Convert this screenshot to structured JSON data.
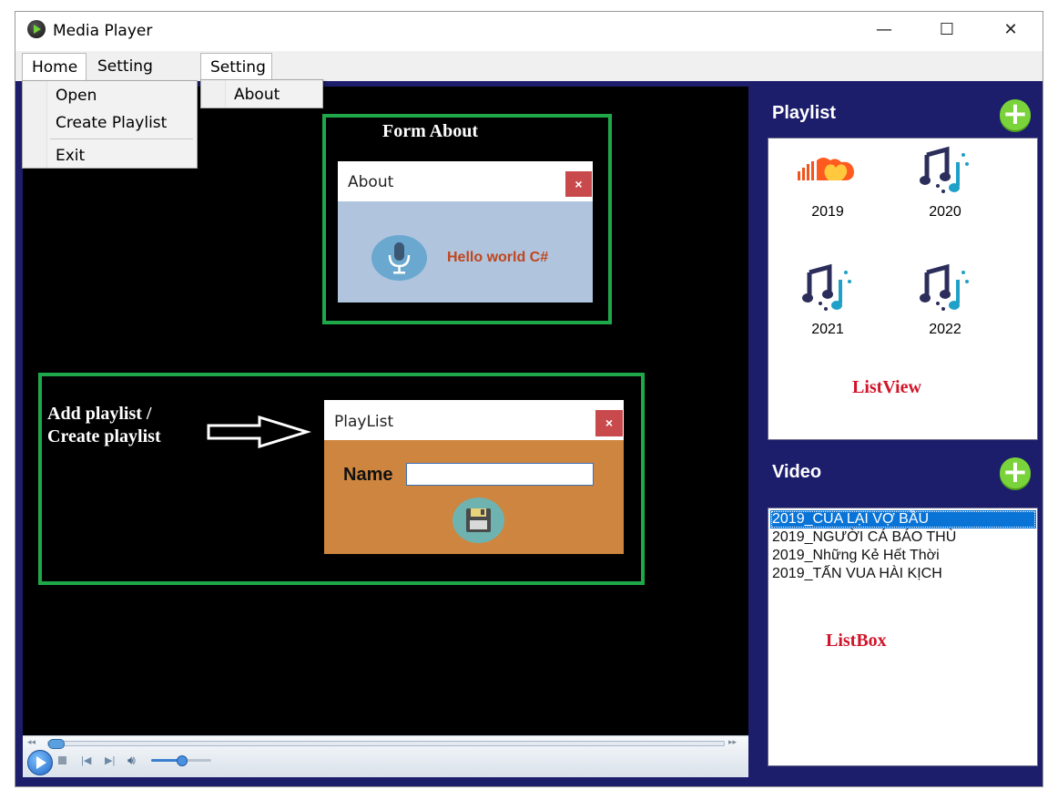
{
  "window": {
    "title": "Media Player",
    "minimize": "—",
    "maximize": "☐",
    "close": "✕"
  },
  "menu": {
    "home": "Home",
    "setting1": "Setting",
    "setting2": "Setting",
    "home_items": [
      "Open",
      "Create Playlist",
      "Exit"
    ],
    "setting_items": [
      "About"
    ]
  },
  "annotations": {
    "form_about": "Form About",
    "add_playlist_1": "Add playlist /",
    "add_playlist_2": "Create playlist",
    "listview": "ListView",
    "listbox": "ListBox"
  },
  "about_dialog": {
    "title": "About",
    "close": "×",
    "message": "Hello world C#"
  },
  "playlist_dialog": {
    "title": "PlayList",
    "close": "×",
    "name_label": "Name",
    "name_value": ""
  },
  "sidebar": {
    "playlist_header": "Playlist",
    "video_header": "Video",
    "playlists": [
      "2019",
      "2020",
      "2021",
      "2022"
    ],
    "videos": [
      "2019_CUA LẠI VỢ BẦU",
      "2019_NGƯỜI CÁ BÁO THÙ",
      "2019_Những Kẻ Hết Thời",
      "2019_TẤN VUA HÀI KỊCH"
    ],
    "selected_video_index": 0
  },
  "player": {
    "volume_fraction": 0.5,
    "seek_fraction": 0.0
  },
  "colors": {
    "window_bg": "#1c1d6b",
    "accent_green": "#1fa84a",
    "selection": "#0a74d6",
    "add_button": "#7ad33a"
  }
}
